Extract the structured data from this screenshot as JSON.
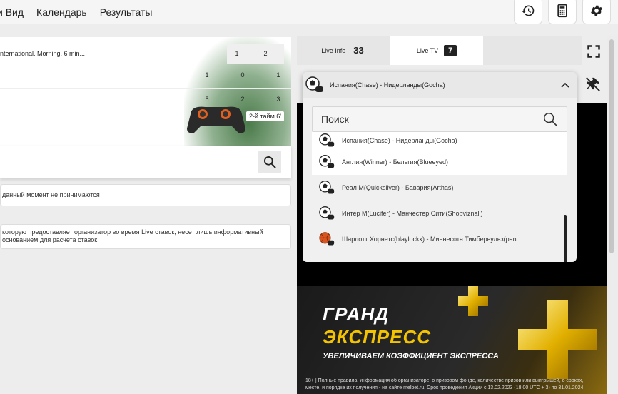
{
  "nav": {
    "items": [
      "и Вид",
      "Календарь",
      "Результаты"
    ]
  },
  "game": {
    "title": "nternational. Morning. 6 min...",
    "header_scores": [
      "1",
      "2"
    ],
    "row1": [
      "1",
      "0",
      "1"
    ],
    "row2": [
      "5",
      "2",
      "3"
    ],
    "period": "2-й тайм   6'"
  },
  "notes": {
    "note1": "данный момент не принимаются",
    "note2_line1": "которую предоставляет организатор во время Live ставок, несет лишь информативный",
    "note2_line2": "основанием для расчета ставок."
  },
  "tabs": {
    "live_info_label": "Live Info",
    "live_info_count": "33",
    "live_tv_label": "Live TV",
    "live_tv_count": "7"
  },
  "dropdown": {
    "selected": "Испания(Chase) - Нидерланды(Gocha)",
    "search_placeholder": "Поиск",
    "items": [
      {
        "label": "Испания(Chase) - Нидерланды(Gocha)",
        "icon": "soccer-gamepad-icon"
      },
      {
        "label": "Англия(Winner) - Бельгия(Blueeyed)",
        "icon": "soccer-gamepad-icon"
      },
      {
        "label": "Реал М(Quicksilver) - Бавария(Arthas)",
        "icon": "soccer-gamepad-icon"
      },
      {
        "label": "Интер М(Lucifer) - Манчестер Сити(Shobviznali)",
        "icon": "soccer-gamepad-icon"
      },
      {
        "label": "Шарлотт Хорнетс(blaylockk) - Миннесота Тимбервулвз(pan...",
        "icon": "basketball-gamepad-icon"
      }
    ]
  },
  "banner": {
    "line1": "ГРАНД",
    "line2": "ЭКСПРЕСС",
    "line3": "УВЕЛИЧИВАЕМ КОЭФФИЦИЕНТ ЭКСПРЕССА",
    "fine": "18+ | Полные правила, информация об организаторе, о призовом фонде, количестве призов или выигрышей, о сроках, месте, и порядке их получения - на сайте melbet.ru. Срок проведения Акции с 13.02.2023 (18:00 UTC + 3) по 31.01.2024"
  },
  "colors": {
    "accent": "#f3c300",
    "dark": "#000000",
    "badge_bg": "#222222"
  }
}
